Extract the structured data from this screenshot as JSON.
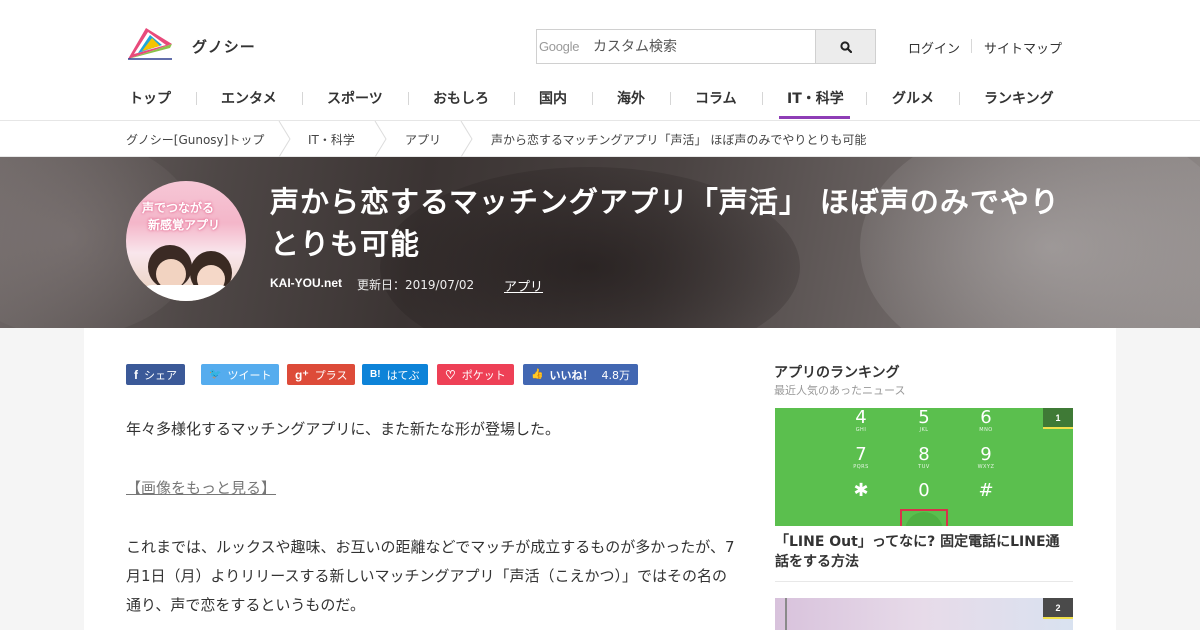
{
  "site": {
    "name": "グノシー"
  },
  "search": {
    "brand": "Google",
    "placeholder": "カスタム検索"
  },
  "util": {
    "login": "ログイン",
    "sitemap": "サイトマップ"
  },
  "nav": {
    "active": "IT・科学",
    "items": [
      "トップ",
      "エンタメ",
      "スポーツ",
      "おもしろ",
      "国内",
      "海外",
      "コラム",
      "IT・科学",
      "グルメ",
      "ランキング"
    ]
  },
  "breadcrumb": [
    "グノシー[Gunosy]トップ",
    "IT・科学",
    "アプリ",
    "声から恋するマッチングアプリ「声活」 ほぼ声のみでやりとりも可能"
  ],
  "article": {
    "title": "声から恋するマッチングアプリ「声活」 ほぼ声のみでやりとりも可能",
    "source": "KAI-YOU.net",
    "updated": "更新日：2019/07/02",
    "category": "アプリ",
    "thumb_text": [
      "声でつながる",
      "新感覚アプリ"
    ],
    "paragraphs": [
      "年々多様化するマッチングアプリに、また新たな形が登場した。",
      "これまでは、ルックスや趣味、お互いの距離などでマッチが成立するものが多かったが、7月1日（月）よりリリースする新しいマッチングアプリ「声活（こえかつ）」ではその名の通り、声で恋をするというものだ。"
    ],
    "more_link": "【画像をもっと見る】"
  },
  "share": {
    "facebook": "シェア",
    "twitter": "ツイート",
    "gplus": "プラス",
    "hatena": "はてぶ",
    "pocket": "ポケット",
    "like": "いいね！",
    "like_count": "4.8万"
  },
  "share_icons": {
    "facebook": "f",
    "twitter": "🐦",
    "gplus": "g⁺",
    "hatena": "B!",
    "pocket": "♡",
    "like": "👍"
  },
  "colors": {
    "nav_active": "#8e3db6",
    "facebook": "#3b5998",
    "twitter": "#55acee",
    "gplus": "#dd4b39",
    "hatena": "#0d83d8",
    "pocket": "#ee4056",
    "like": "#4267b2",
    "ranking_image": "#5bbf4e"
  },
  "sidebar": {
    "title": "アプリのランキング",
    "subtitle": "最近人気のあったニュース",
    "items": [
      {
        "rank": "1",
        "title": "「LINE Out」ってなに? 固定電話にLINE通話をする方法"
      },
      {
        "rank": "2"
      }
    ],
    "keypad": [
      {
        "n": "4",
        "s": "GHI"
      },
      {
        "n": "5",
        "s": "JKL"
      },
      {
        "n": "6",
        "s": "MNO"
      },
      {
        "n": "7",
        "s": "PQRS"
      },
      {
        "n": "8",
        "s": "TUV"
      },
      {
        "n": "9",
        "s": "WXYZ"
      },
      {
        "n": "✱",
        "s": ""
      },
      {
        "n": "0",
        "s": ""
      },
      {
        "n": "#",
        "s": ""
      }
    ]
  }
}
